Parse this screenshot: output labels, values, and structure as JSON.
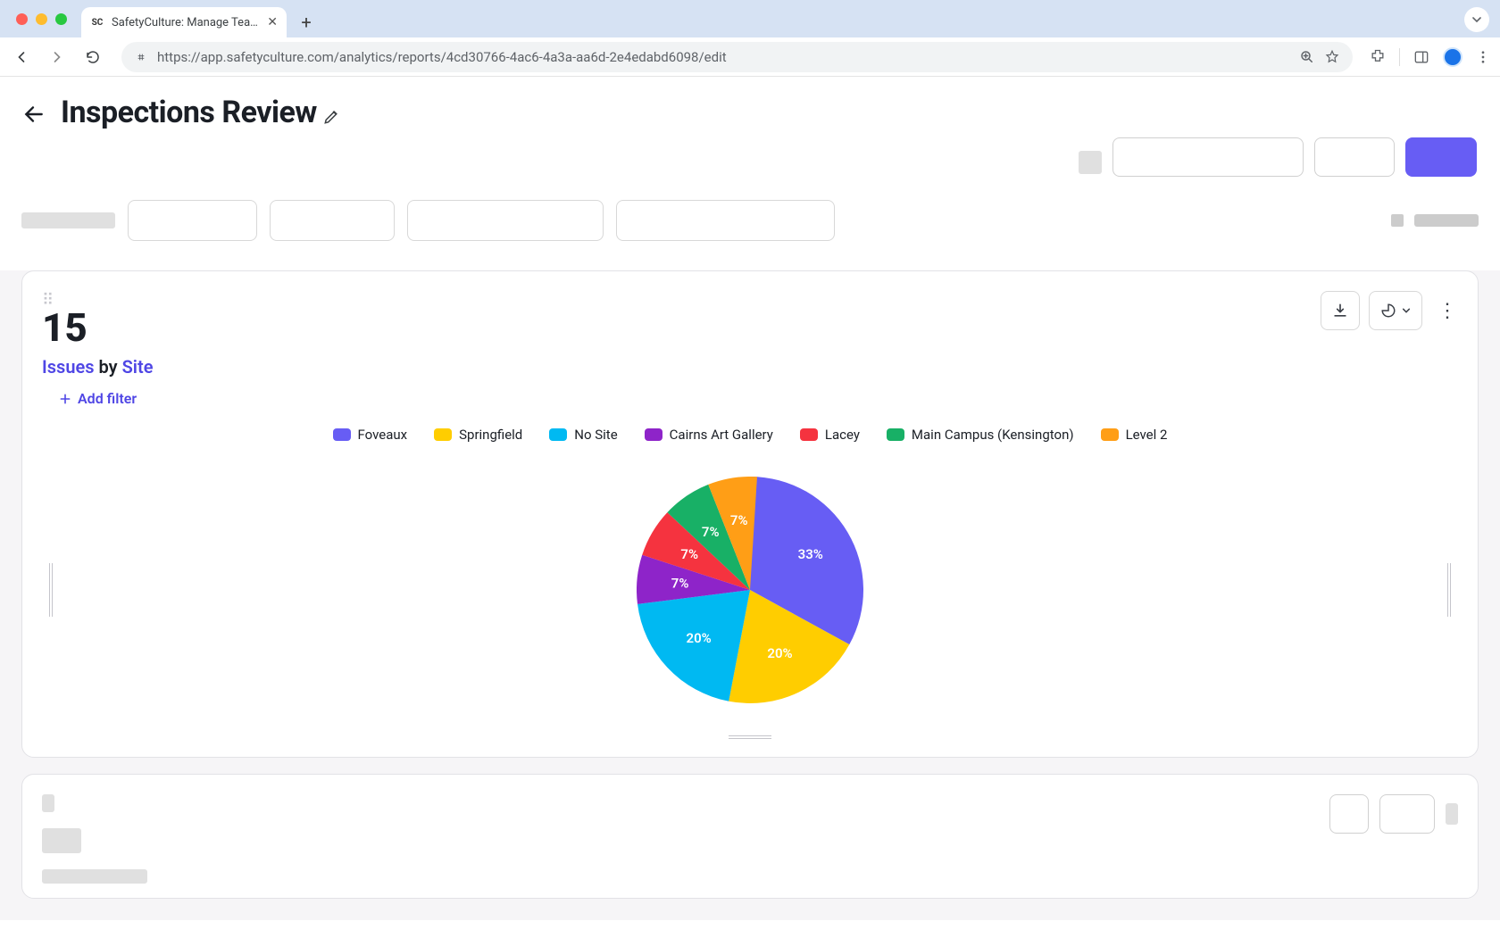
{
  "browser": {
    "tab_title": "SafetyCulture: Manage Teams and…",
    "url": "https://app.safetyculture.com/analytics/reports/4cd30766-4ac6-4a3a-aa6d-2e4edabd6098/edit"
  },
  "page": {
    "title": "Inspections Review"
  },
  "card": {
    "metric_value": "15",
    "metric_link": "Issues",
    "metric_by": "by",
    "metric_dim": "Site",
    "add_filter_label": "Add filter"
  },
  "chart_data": {
    "type": "pie",
    "title": "Issues by Site",
    "series": [
      {
        "name": "Foveaux",
        "pct": 33,
        "color": "#675df4"
      },
      {
        "name": "Springfield",
        "pct": 20,
        "color": "#ffcd00"
      },
      {
        "name": "No Site",
        "pct": 20,
        "color": "#00b9f2"
      },
      {
        "name": "Cairns Art Gallery",
        "pct": 7,
        "color": "#8e24c9"
      },
      {
        "name": "Lacey",
        "pct": 7,
        "color": "#f5333f"
      },
      {
        "name": "Main Campus (Kensington)",
        "pct": 7,
        "color": "#18b066"
      },
      {
        "name": "Level 2",
        "pct": 7,
        "color": "#ff9e16"
      }
    ]
  }
}
